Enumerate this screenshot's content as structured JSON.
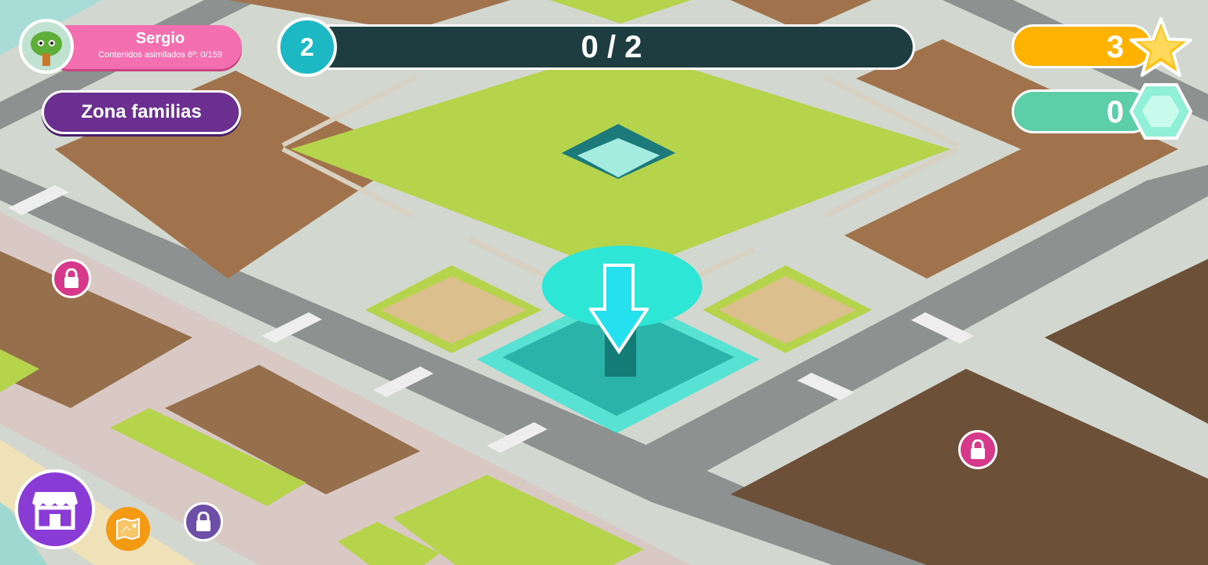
{
  "profile": {
    "name": "Sergio",
    "subtitle": "Contenidos asimilados 6º:  0/159",
    "avatar_icon": "tree-character-avatar"
  },
  "zone_button": {
    "label": "Zona familias"
  },
  "progress": {
    "level": "2",
    "text": "0 / 2",
    "value": 0,
    "max": 2
  },
  "currencies": {
    "stars": {
      "value": "3",
      "icon": "star-icon",
      "color": "#ffb300"
    },
    "gems": {
      "value": "0",
      "icon": "gem-icon",
      "color": "#5ccfa8"
    }
  },
  "bottom_bar": {
    "shop_icon": "shop-icon",
    "map_icon": "map-icon",
    "lock_icon": "lock-icon"
  },
  "map": {
    "locked_plots": 3,
    "highlight_icon": "down-arrow-icon",
    "colors": {
      "grass": "#b5d44b",
      "road": "#8f8f8f",
      "plot": "#a0734c",
      "highlight": "#2ee6d6",
      "lock": "#d6388a"
    }
  }
}
